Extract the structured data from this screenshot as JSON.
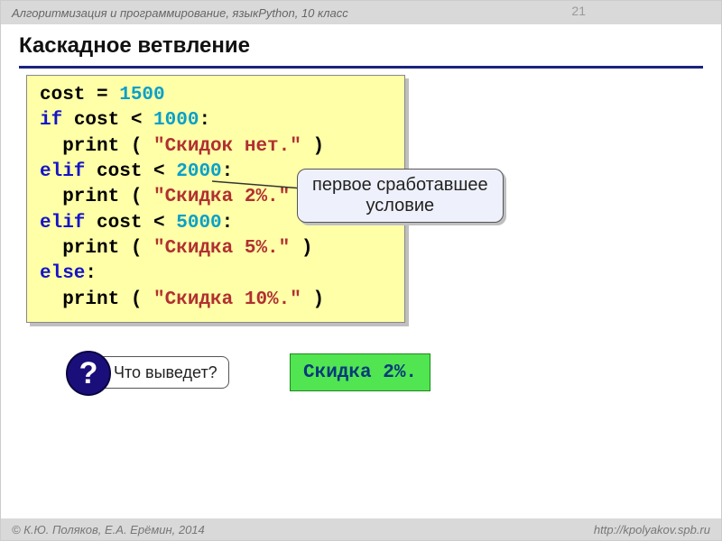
{
  "page_number": "21",
  "header": {
    "course_prefix": "Алгоритмизация и программирование, язык ",
    "course_lang": "Python",
    "course_suffix": ", 10 класс"
  },
  "title": "Каскадное ветвление",
  "code": {
    "l1_a": "cost = ",
    "l1_n": "1500",
    "l2_kw": "if",
    "l2_b": " cost < ",
    "l2_n": "1000",
    "l2_c": ":",
    "l3_a": "  print ( ",
    "l3_s": "\"Скидок нет.\"",
    "l3_b": " )",
    "l4_kw": "elif",
    "l4_b": " cost < ",
    "l4_n": "2000",
    "l4_c": ":",
    "l5_a": "  print ( ",
    "l5_s": "\"Скидка 2%.\"",
    "l5_b": " )",
    "l6_kw": "elif",
    "l6_b": " cost < ",
    "l6_n": "5000",
    "l6_c": ":",
    "l7_a": "  print ( ",
    "l7_s": "\"Скидка 5%.\"",
    "l7_b": " )",
    "l8_kw": "else",
    "l8_c": ":",
    "l9_a": "  print ( ",
    "l9_s": "\"Скидка 10%.\"",
    "l9_b": " )"
  },
  "annotation": {
    "line1": "первое сработавшее",
    "line2": "условие"
  },
  "question": {
    "mark": "?",
    "text": "Что выведет?"
  },
  "answer": "Скидка 2%.",
  "footer": {
    "left_copyright": "© ",
    "left_authors": "К.Ю. Поляков, Е.А. Ерёмин, 2014",
    "right": "http://kpolyakov.spb.ru"
  }
}
